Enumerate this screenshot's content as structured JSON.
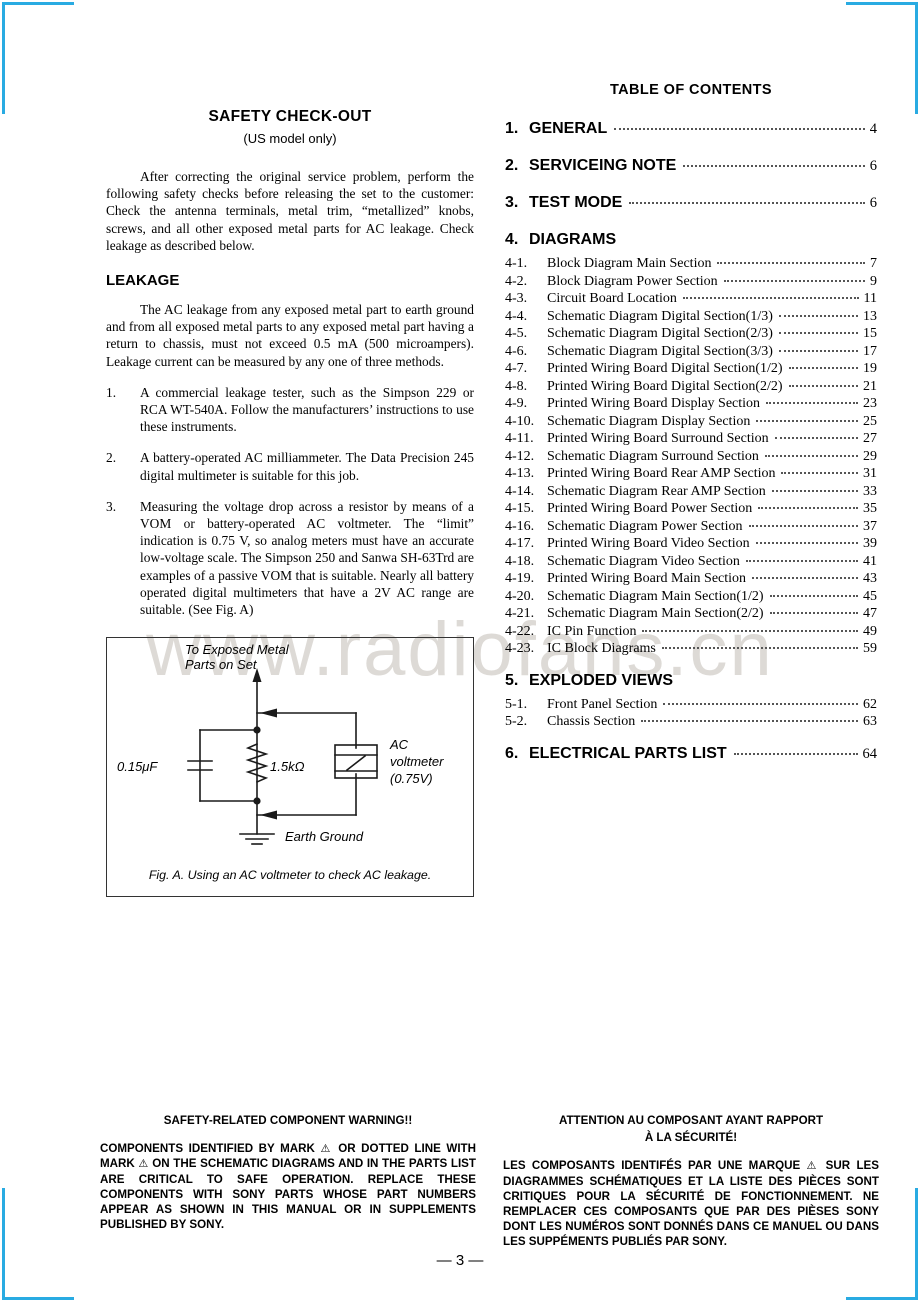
{
  "page": {
    "number_label": "— 3 —",
    "watermark": "www.radiofans.cn"
  },
  "safety_checkout": {
    "title": "SAFETY  CHECK-OUT",
    "subtitle": "(US model only)",
    "intro": "After correcting the original service problem, perform the following safety checks before releasing the set to the customer: Check the antenna terminals, metal trim, “metallized” knobs, screws, and all other exposed metal parts for AC leakage. Check leakage as described below.",
    "leakage_heading": "LEAKAGE",
    "leakage_intro": "The AC leakage from any exposed metal part to earth ground and from all exposed metal parts to any exposed metal part having a return to chassis, must not exceed 0.5 mA (500 microampers). Leakage current can be measured by any one of three methods.",
    "methods": [
      {
        "num": "1.",
        "text": "A commercial leakage tester, such as the Simpson 229 or RCA WT-540A. Follow the manufacturers’ instructions to use these instruments."
      },
      {
        "num": "2.",
        "text": "A battery-operated AC milliammeter. The Data Precision 245 digital multimeter is suitable for this job."
      },
      {
        "num": "3.",
        "text": "Measuring the voltage drop across a resistor by means of a VOM or battery-operated AC voltmeter. The “limit” indication is 0.75 V, so analog meters must have an accurate low-voltage scale. The Simpson 250 and Sanwa SH-63Trd are examples of a passive VOM that is suitable. Nearly all battery operated digital multimeters that have a 2V AC range are suitable. (See Fig. A)"
      }
    ]
  },
  "figure": {
    "top_label_line1": "To Exposed Metal",
    "top_label_line2": "Parts on Set",
    "capacitor_label": "0.15μF",
    "resistor_label": "1.5kΩ",
    "meter_label_line1": "AC",
    "meter_label_line2": "voltmeter",
    "meter_label_line3": "(0.75V)",
    "ground_label": "Earth Ground",
    "caption": "Fig. A.  Using an AC voltmeter to check AC leakage."
  },
  "toc": {
    "title": "TABLE OF CONTENTS",
    "majors": [
      {
        "num": "1.",
        "label": "GENERAL",
        "page": "4",
        "has_dots": true
      },
      {
        "num": "2.",
        "label": "SERVICEING NOTE",
        "page": "6",
        "has_dots": true
      },
      {
        "num": "3.",
        "label": "TEST MODE",
        "page": "6",
        "has_dots": true
      },
      {
        "num": "4.",
        "label": "DIAGRAMS",
        "page": "",
        "has_dots": false
      },
      {
        "num": "5.",
        "label": "EXPLODED VIEWS",
        "page": "",
        "has_dots": false
      },
      {
        "num": "6.",
        "label": "ELECTRICAL PARTS LIST",
        "page": "64",
        "has_dots": true
      }
    ],
    "diagrams": [
      {
        "num": "4-1.",
        "label": "Block Diagram   Main Section",
        "page": "7"
      },
      {
        "num": "4-2.",
        "label": "Block Diagram   Power Section",
        "page": "9"
      },
      {
        "num": "4-3.",
        "label": "Circuit Board Location",
        "page": "11"
      },
      {
        "num": "4-4.",
        "label": "Schematic Diagram   Digital Section(1/3)",
        "page": "13"
      },
      {
        "num": "4-5.",
        "label": "Schematic Diagram   Digital Section(2/3)",
        "page": "15"
      },
      {
        "num": "4-6.",
        "label": "Schematic Diagram   Digital Section(3/3)",
        "page": "17"
      },
      {
        "num": "4-7.",
        "label": "Printed Wiring Board   Digital Section(1/2)",
        "page": "19"
      },
      {
        "num": "4-8.",
        "label": "Printed Wiring Board   Digital Section(2/2)",
        "page": "21"
      },
      {
        "num": "4-9.",
        "label": "Printed Wiring Board   Display Section",
        "page": "23"
      },
      {
        "num": "4-10.",
        "label": "Schematic Diagram   Display Section",
        "page": "25"
      },
      {
        "num": "4-11.",
        "label": "Printed Wiring Board   Surround Section",
        "page": "27"
      },
      {
        "num": "4-12.",
        "label": "Schematic Diagram   Surround Section",
        "page": "29"
      },
      {
        "num": "4-13.",
        "label": "Printed Wiring Board   Rear AMP Section",
        "page": "31"
      },
      {
        "num": "4-14.",
        "label": "Schematic Diagram   Rear AMP Section",
        "page": "33"
      },
      {
        "num": "4-15.",
        "label": "Printed Wiring Board   Power Section",
        "page": "35"
      },
      {
        "num": "4-16.",
        "label": "Schematic Diagram   Power Section",
        "page": "37"
      },
      {
        "num": "4-17.",
        "label": "Printed Wiring Board   Video Section",
        "page": "39"
      },
      {
        "num": "4-18.",
        "label": "Schematic Diagram   Video Section",
        "page": "41"
      },
      {
        "num": "4-19.",
        "label": "Printed Wiring Board   Main Section",
        "page": "43"
      },
      {
        "num": "4-20.",
        "label": "Schematic Diagram   Main Section(1/2)",
        "page": "45"
      },
      {
        "num": "4-21.",
        "label": "Schematic Diagram   Main Section(2/2)",
        "page": "47"
      },
      {
        "num": "4-22.",
        "label": "IC Pin Function",
        "page": "49"
      },
      {
        "num": "4-23.",
        "label": "IC Block Diagrams",
        "page": "59"
      }
    ],
    "exploded": [
      {
        "num": "5-1.",
        "label": "Front Panel Section",
        "page": "62"
      },
      {
        "num": "5-2.",
        "label": "Chassis Section",
        "page": "63"
      }
    ]
  },
  "warnings": {
    "english": {
      "heading": "SAFETY-RELATED COMPONENT WARNING!!",
      "body_part1": "COMPONENTS IDENTIFIED BY MARK ",
      "body_part2": " OR DOTTED LINE WITH MARK ",
      "body_part3": " ON THE SCHEMATIC DIAGRAMS AND IN THE PARTS LIST ARE CRITICAL TO SAFE OPERATION. REPLACE THESE COMPONENTS WITH SONY PARTS WHOSE PART NUMBERS APPEAR AS SHOWN IN THIS MANUAL OR IN SUPPLEMENTS PUBLISHED BY SONY.",
      "mark_glyph": "⚠"
    },
    "french": {
      "heading_line1": "ATTENTION AU COMPOSANT AYANT RAPPORT",
      "heading_line2": "À LA SÉCURITÉ!",
      "body_part1": "LES COMPOSANTS IDENTIFÉS PAR UNE MARQUE ",
      "body_part2": " SUR LES DIAGRAMMES SCHÉMATIQUES ET LA LISTE DES PIÈCES SONT CRITIQUES POUR LA SÉCURITÉ DE FONCTIONNEMENT. NE REMPLACER CES COMPOSANTS QUE PAR DES PIÈSES SONY DONT LES NUMÉROS SONT DONNÉS DANS CE MANUEL OU DANS LES SUPPÉMENTS PUBLIÉS PAR SONY.",
      "mark_glyph": "⚠"
    }
  },
  "colors": {
    "crop_mark": "#29ABE2",
    "text": "#000000",
    "watermark": "#d8d4cf"
  }
}
